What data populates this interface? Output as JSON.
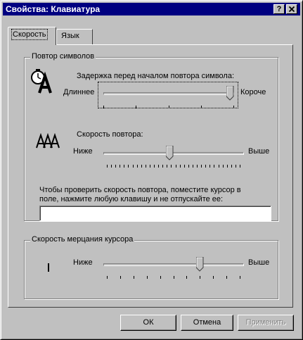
{
  "window": {
    "title": "Свойства: Клавиатура",
    "help_button": "?",
    "close_button": "×"
  },
  "tabs": [
    {
      "label": "Скорость",
      "active": true
    },
    {
      "label": "Язык",
      "active": false
    }
  ],
  "repeat_group": {
    "legend": "Повтор символов",
    "delay": {
      "label": "Задержка перед началом повтора символа:",
      "min_label": "Длиннее",
      "max_label": "Короче",
      "value_fraction": 1.0
    },
    "rate": {
      "label": "Скорость повтора:",
      "min_label": "Ниже",
      "max_label": "Выше",
      "value_fraction": 0.47
    },
    "test": {
      "label_line1": "Чтобы проверить скорость повтора, поместите курсор в",
      "label_line2": "поле, нажмите любую клавишу и не отпускайте ее:",
      "value": ""
    }
  },
  "cursor_group": {
    "legend": "Скорость мерцания курсора",
    "min_label": "Ниже",
    "max_label": "Выше",
    "value_fraction": 0.7
  },
  "buttons": {
    "ok": "ОК",
    "cancel": "Отмена",
    "apply": "Применить"
  },
  "icons": {
    "delay": "stopwatch-letter-icon",
    "rate": "repeat-letters-icon",
    "cursor": "text-cursor-icon"
  }
}
